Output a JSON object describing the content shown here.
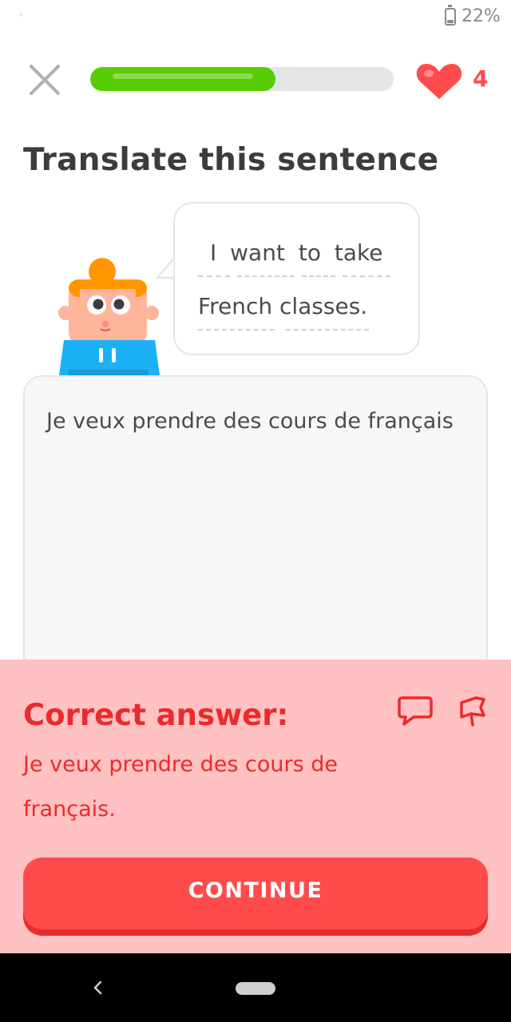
{
  "status_bar": {
    "battery_percent": "22%"
  },
  "header": {
    "progress": 0.61,
    "hearts": "4"
  },
  "exercise": {
    "title": "Translate this sentence",
    "prompt_line_1": "I want to take",
    "prompt_line_2": "French classes.",
    "user_answer": "Je veux prendre des cours de français"
  },
  "feedback": {
    "title": "Correct answer:",
    "correct_answer": "Je veux prendre des cours de français.",
    "continue_label": "CONTINUE"
  },
  "colors": {
    "progress_green": "#58cc02",
    "error_red": "#ea2b2b",
    "panel_bg": "#ffc1c1",
    "button_red": "#ff4b4b"
  },
  "icons": {
    "close": "close-icon",
    "heart": "heart-icon",
    "comment": "comment-icon",
    "flag": "flag-icon",
    "back": "back-icon"
  }
}
